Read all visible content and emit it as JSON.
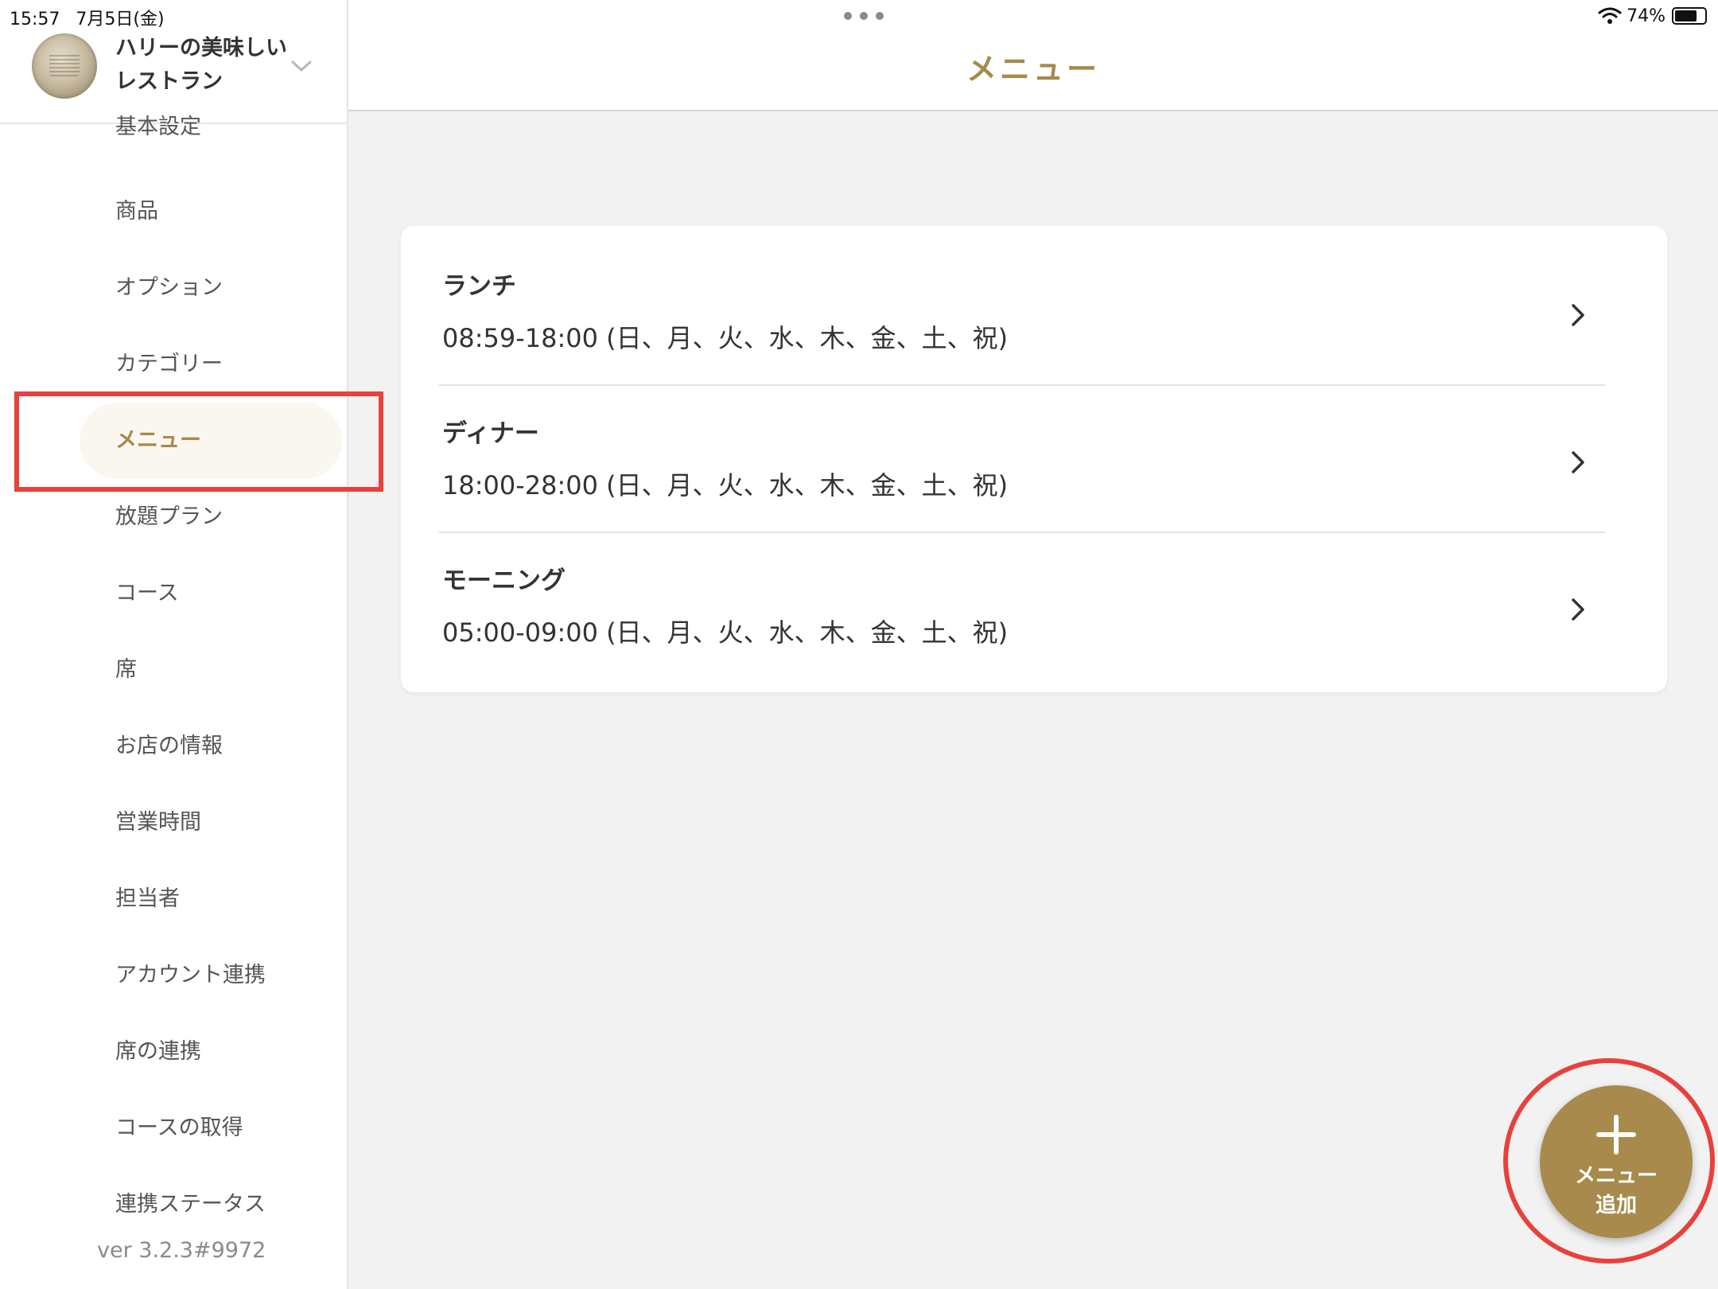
{
  "status_bar": {
    "time": "15:57",
    "date": "7月5日(金)",
    "battery": "74%",
    "battery_level": 0.74
  },
  "store": {
    "name": "ハリーの美味しいレストラン",
    "chevron_icon": "chevron-down-icon"
  },
  "sidebar": {
    "items": [
      {
        "label": "基本設定",
        "active": false
      },
      {
        "label": "商品",
        "active": false
      },
      {
        "label": "オプション",
        "active": false
      },
      {
        "label": "カテゴリー",
        "active": false
      },
      {
        "label": "メニュー",
        "active": true
      },
      {
        "label": "放題プラン",
        "active": false
      },
      {
        "label": "コース",
        "active": false
      },
      {
        "label": "席",
        "active": false
      },
      {
        "label": "お店の情報",
        "active": false
      },
      {
        "label": "営業時間",
        "active": false
      },
      {
        "label": "担当者",
        "active": false
      },
      {
        "label": "アカウント連携",
        "active": false
      },
      {
        "label": "席の連携",
        "active": false
      },
      {
        "label": "コースの取得",
        "active": false
      },
      {
        "label": "連携ステータス",
        "active": false
      }
    ],
    "version": "ver 3.2.3#9972"
  },
  "header": {
    "title": "メニュー"
  },
  "menus": [
    {
      "name": "ランチ",
      "hours": "08:59-18:00 (日、月、火、水、木、金、土、祝)"
    },
    {
      "name": "ディナー",
      "hours": "18:00-28:00 (日、月、火、水、木、金、土、祝)"
    },
    {
      "name": "モーニング",
      "hours": "05:00-09:00 (日、月、火、水、木、金、土、祝)"
    }
  ],
  "fab": {
    "label": "メニュー\n追加",
    "icon": "plus-icon"
  },
  "colors": {
    "accent": "#a78a4c",
    "highlight": "#e8413b",
    "background": "#f2f2f2"
  }
}
